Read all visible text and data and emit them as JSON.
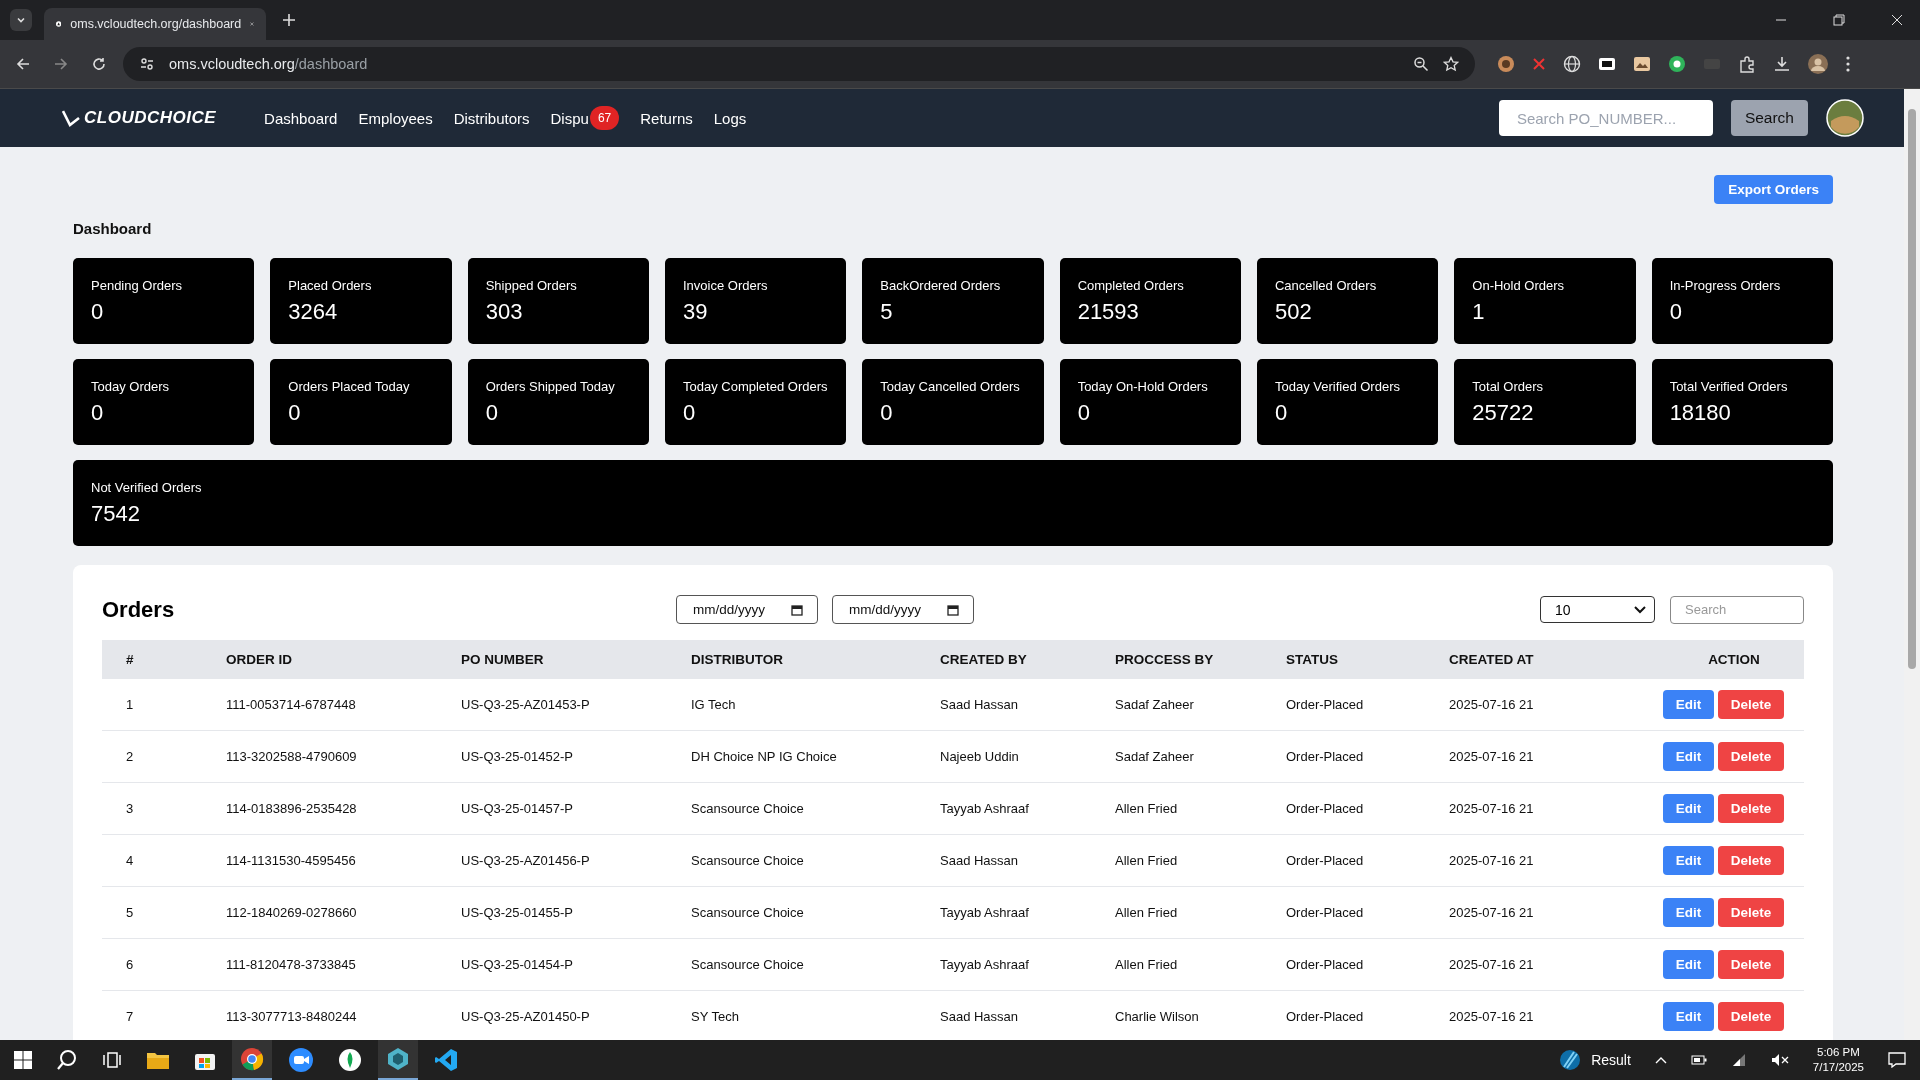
{
  "browser": {
    "tab_title": "oms.vcloudtech.org/dashboard",
    "url_host": "oms.vcloudtech.org",
    "url_path": "/dashboard"
  },
  "nav": {
    "logo": "CLOUDCHOICE",
    "links": [
      {
        "label": "Dashboard"
      },
      {
        "label": "Employees"
      },
      {
        "label": "Distributors"
      },
      {
        "label": "Dispu",
        "badge": "67"
      },
      {
        "label": "Returns"
      },
      {
        "label": "Logs"
      }
    ],
    "search_placeholder": "Search PO_NUMBER...",
    "search_button": "Search"
  },
  "export_button": "Export Orders",
  "dashboard_title": "Dashboard",
  "stat_rows": [
    [
      {
        "label": "Pending Orders",
        "value": "0"
      },
      {
        "label": "Placed Orders",
        "value": "3264"
      },
      {
        "label": "Shipped Orders",
        "value": "303"
      },
      {
        "label": "Invoice Orders",
        "value": "39"
      },
      {
        "label": "BackOrdered Orders",
        "value": "5"
      },
      {
        "label": "Completed Orders",
        "value": "21593"
      },
      {
        "label": "Cancelled Orders",
        "value": "502"
      },
      {
        "label": "On-Hold Orders",
        "value": "1"
      },
      {
        "label": "In-Progress Orders",
        "value": "0"
      }
    ],
    [
      {
        "label": "Today Orders",
        "value": "0"
      },
      {
        "label": "Orders Placed Today",
        "value": "0"
      },
      {
        "label": "Orders Shipped Today",
        "value": "0"
      },
      {
        "label": "Today Completed Orders",
        "value": "0"
      },
      {
        "label": "Today Cancelled Orders",
        "value": "0"
      },
      {
        "label": "Today On-Hold Orders",
        "value": "0"
      },
      {
        "label": "Today Verified Orders",
        "value": "0"
      },
      {
        "label": "Total Orders",
        "value": "25722"
      },
      {
        "label": "Total Verified Orders",
        "value": "18180"
      }
    ],
    [
      {
        "label": "Not Verified Orders",
        "value": "7542"
      }
    ]
  ],
  "orders": {
    "title": "Orders",
    "date_from": {
      "placeholder": "mm/dd/yyyy"
    },
    "date_to": {
      "placeholder": "mm/dd/yyyy"
    },
    "page_size": "10",
    "search": {
      "placeholder": "Search"
    },
    "columns": [
      "#",
      "ORDER ID",
      "PO NUMBER",
      "DISTRIBUTOR",
      "CREATED BY",
      "PROCCESS BY",
      "STATUS",
      "CREATED AT",
      "ACTION"
    ],
    "rows": [
      {
        "n": "1",
        "order_id": "111-0053714-6787448",
        "po": "US-Q3-25-AZ01453-P",
        "distributor": "IG Tech",
        "created_by": "Saad Hassan",
        "process_by": "Sadaf Zaheer",
        "status": "Order-Placed",
        "created_at": "2025-07-16 21",
        "edit": "Edit",
        "delete": "Delete"
      },
      {
        "n": "2",
        "order_id": "113-3202588-4790609",
        "po": "US-Q3-25-01452-P",
        "distributor": "DH Choice NP IG Choice",
        "created_by": "Najeeb Uddin",
        "process_by": "Sadaf Zaheer",
        "status": "Order-Placed",
        "created_at": "2025-07-16 21",
        "edit": "Edit",
        "delete": "Delete"
      },
      {
        "n": "3",
        "order_id": "114-0183896-2535428",
        "po": "US-Q3-25-01457-P",
        "distributor": "Scansource Choice",
        "created_by": "Tayyab Ashraaf",
        "process_by": "Allen Fried",
        "status": "Order-Placed",
        "created_at": "2025-07-16 21",
        "edit": "Edit",
        "delete": "Delete"
      },
      {
        "n": "4",
        "order_id": "114-1131530-4595456",
        "po": "US-Q3-25-AZ01456-P",
        "distributor": "Scansource Choice",
        "created_by": "Saad Hassan",
        "process_by": "Allen Fried",
        "status": "Order-Placed",
        "created_at": "2025-07-16 21",
        "edit": "Edit",
        "delete": "Delete"
      },
      {
        "n": "5",
        "order_id": "112-1840269-0278660",
        "po": "US-Q3-25-01455-P",
        "distributor": "Scansource Choice",
        "created_by": "Tayyab Ashraaf",
        "process_by": "Allen Fried",
        "status": "Order-Placed",
        "created_at": "2025-07-16 21",
        "edit": "Edit",
        "delete": "Delete"
      },
      {
        "n": "6",
        "order_id": "111-8120478-3733845",
        "po": "US-Q3-25-01454-P",
        "distributor": "Scansource Choice",
        "created_by": "Tayyab Ashraaf",
        "process_by": "Allen Fried",
        "status": "Order-Placed",
        "created_at": "2025-07-16 21",
        "edit": "Edit",
        "delete": "Delete"
      },
      {
        "n": "7",
        "order_id": "113-3077713-8480244",
        "po": "US-Q3-25-AZ01450-P",
        "distributor": "SY Tech",
        "created_by": "Saad Hassan",
        "process_by": "Charlie Wilson",
        "status": "Order-Placed",
        "created_at": "2025-07-16 21",
        "edit": "Edit",
        "delete": "Delete"
      }
    ]
  },
  "taskbar": {
    "weather": "Result",
    "time": "5:06 PM",
    "date": "7/17/2025"
  }
}
